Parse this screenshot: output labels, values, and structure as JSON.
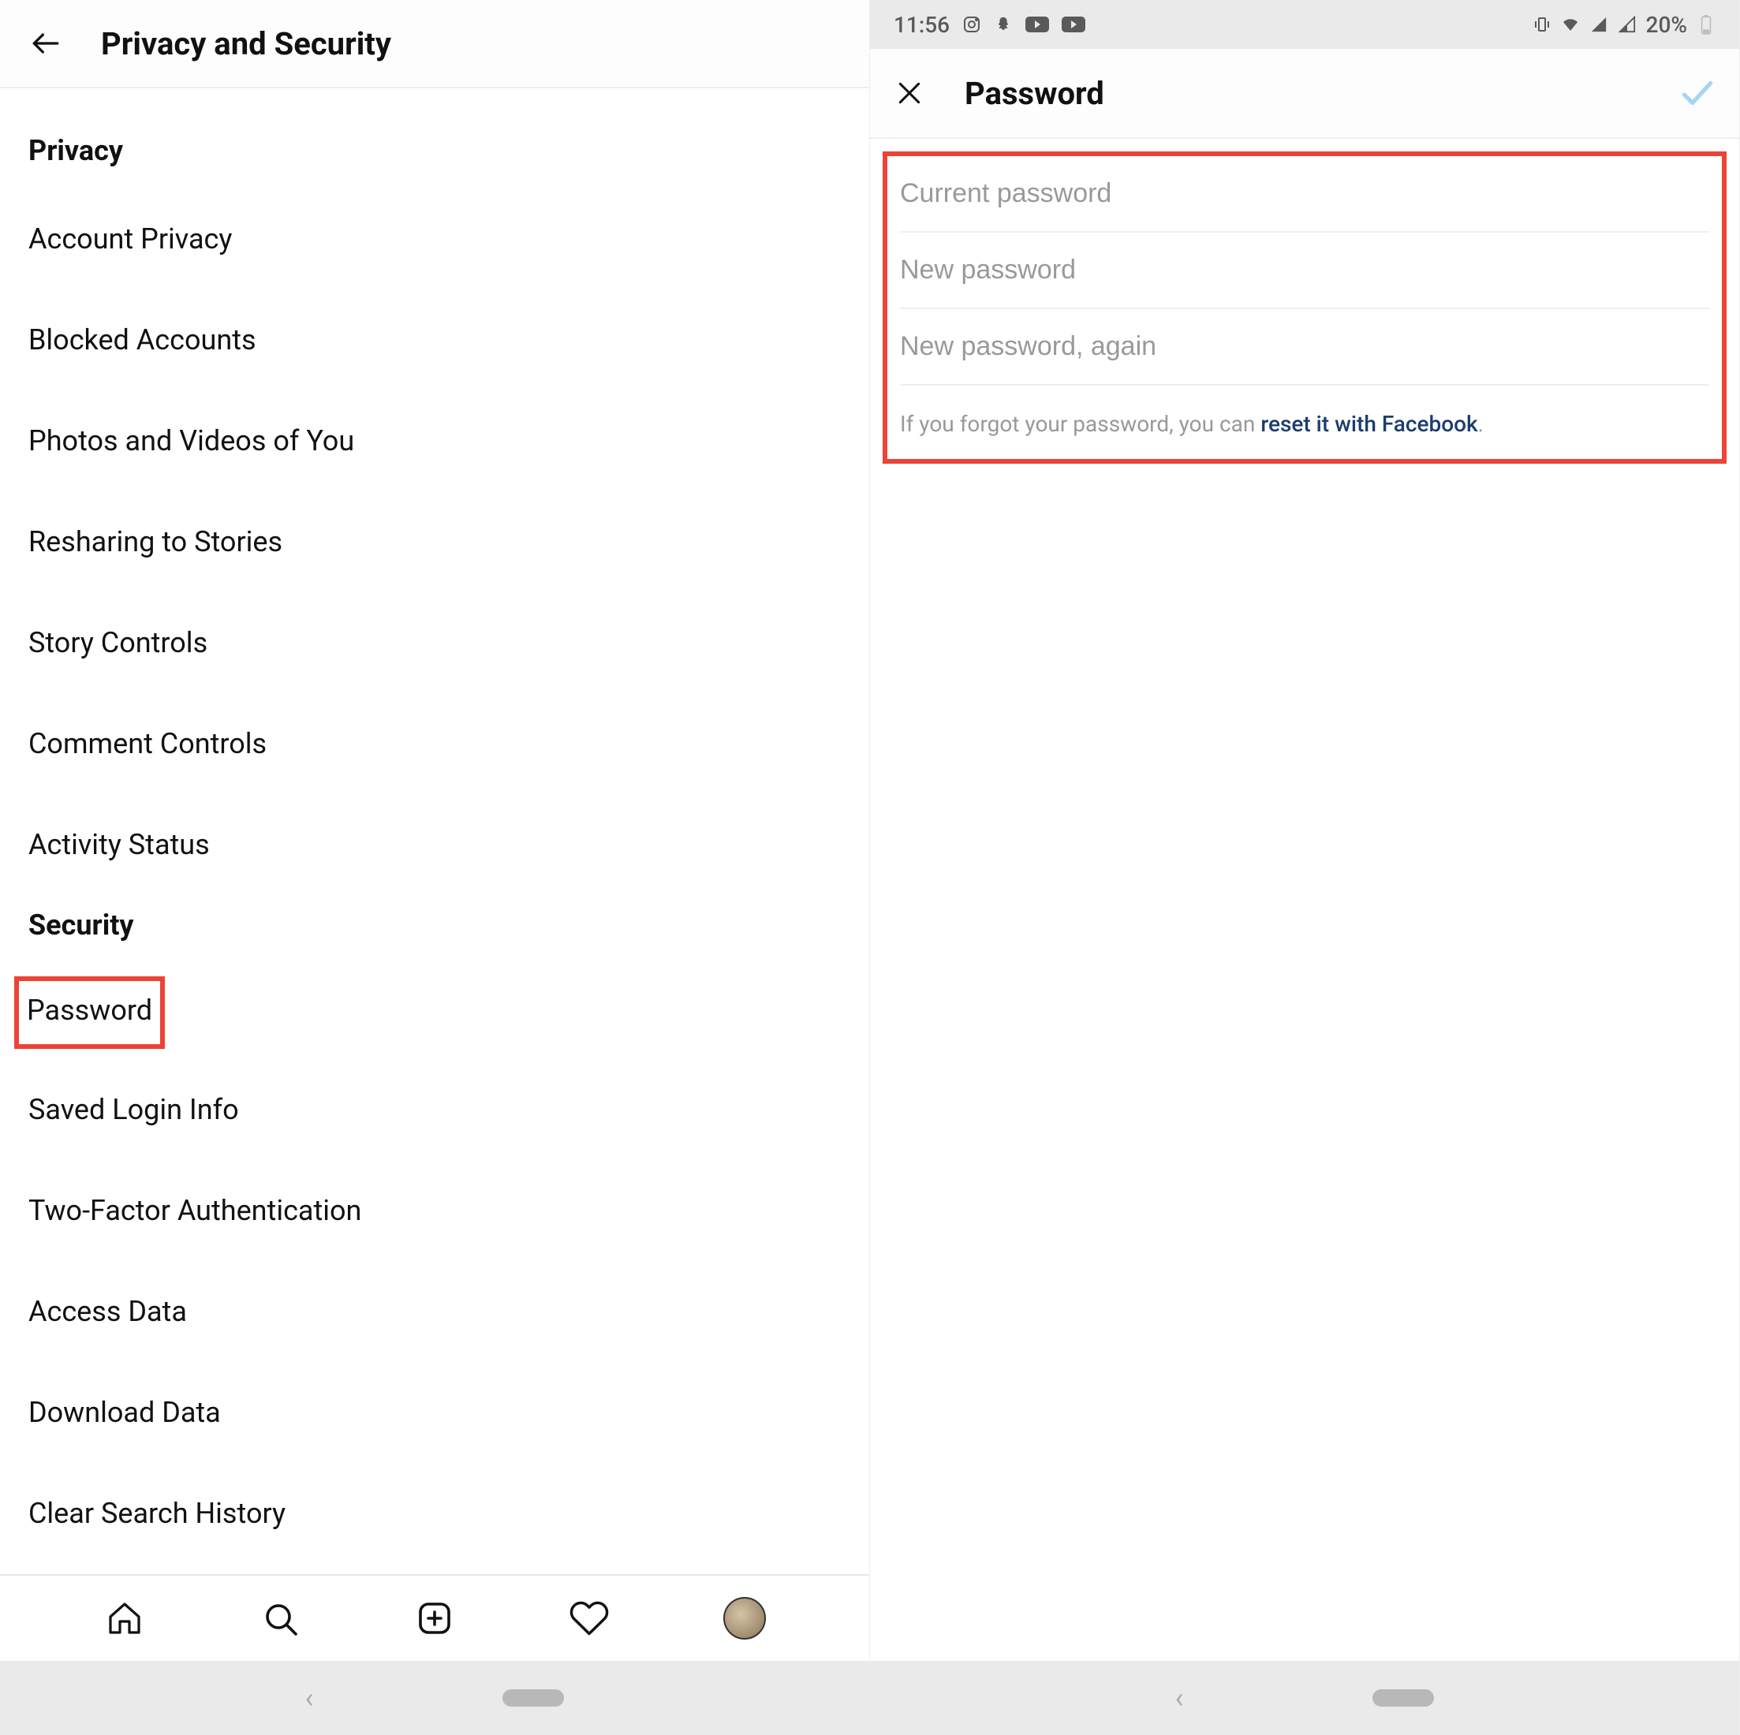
{
  "screen1": {
    "header_title": "Privacy and Security",
    "privacy_section_header": "Privacy",
    "privacy_items": [
      "Account Privacy",
      "Blocked Accounts",
      "Photos and Videos of You",
      "Resharing to Stories",
      "Story Controls",
      "Comment Controls",
      "Activity Status"
    ],
    "security_section_header": "Security",
    "security_item_password": "Password",
    "security_items_rest": [
      "Saved Login Info",
      "Two-Factor Authentication",
      "Access Data",
      "Download Data",
      "Clear Search History"
    ]
  },
  "screen2": {
    "status_time": "11:56",
    "status_battery": "20%",
    "header_title": "Password",
    "current_password_placeholder": "Current password",
    "new_password_placeholder": "New password",
    "new_password_again_placeholder": "New password, again",
    "forgot_prefix": "If you forgot your password, you can ",
    "forgot_link": "reset it with Facebook",
    "forgot_suffix": "."
  }
}
